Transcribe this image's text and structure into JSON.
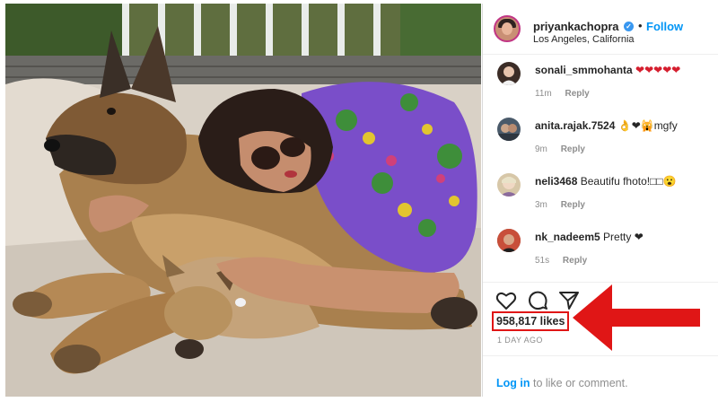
{
  "post": {
    "username": "priyankachopra",
    "verified_badge": "✓",
    "separator": "•",
    "follow_label": "Follow",
    "location": "Los Angeles, California",
    "likes": "958,817 likes",
    "time_ago": "1 DAY AGO"
  },
  "comments": [
    {
      "user": "sonali_smmohanta",
      "text": "❤❤❤❤❤",
      "time": "11m",
      "reply": "Reply",
      "avatar_color": "#3b2c26"
    },
    {
      "user": "anita.rajak.7524",
      "text": "👌❤🙀mgfy",
      "time": "9m",
      "reply": "Reply",
      "avatar_color": "#4a5a6a"
    },
    {
      "user": "neli3468",
      "text": "Beautifu fhoto!□□😮",
      "time": "3m",
      "reply": "Reply",
      "avatar_color": "#d7c7a8"
    },
    {
      "user": "nk_nadeem5",
      "text": "Pretty ❤",
      "time": "51s",
      "reply": "Reply",
      "avatar_color": "#8a4a3a"
    }
  ],
  "login": {
    "link": "Log in",
    "rest": " to like or comment."
  },
  "icons": [
    "heart-icon",
    "comment-icon",
    "share-icon",
    "verified-icon",
    "red-arrow-annotation"
  ],
  "colors": {
    "link_blue": "#0095f6",
    "annotation_red": "#e01616",
    "heart_red": "#d51e2e",
    "muted": "#8e8e8e"
  }
}
